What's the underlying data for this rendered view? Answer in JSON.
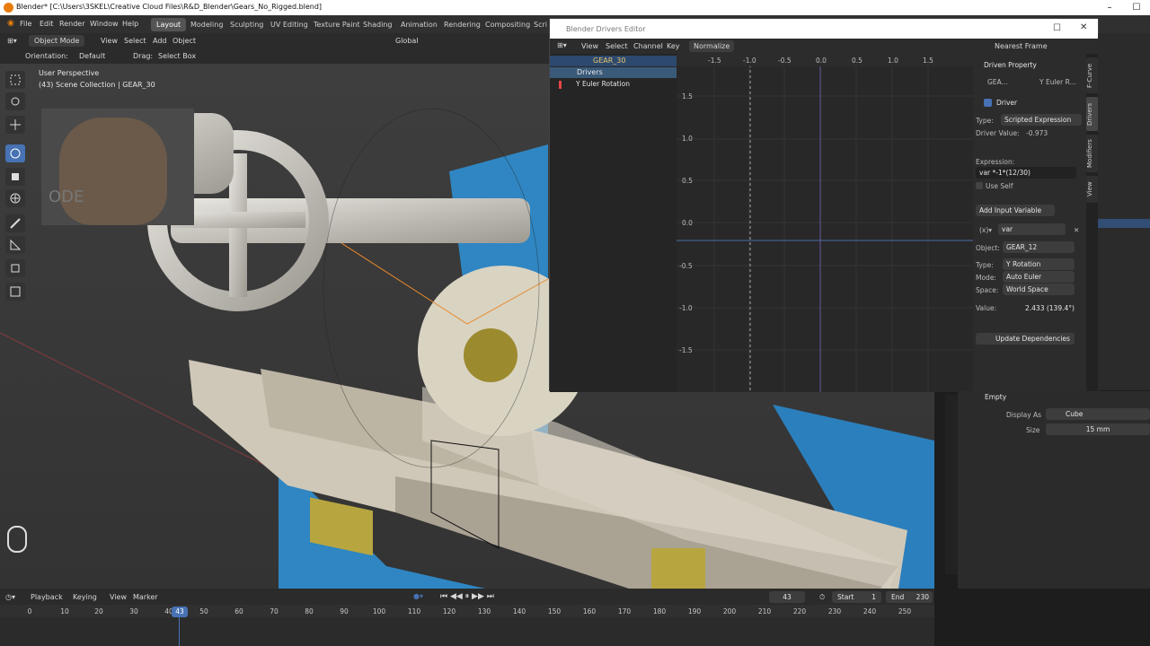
{
  "window": {
    "title": "Blender* [C:\\Users\\3SKEL\\Creative Cloud Files\\R&D_Blender\\Gears_No_Rigged.blend]"
  },
  "menu": [
    "File",
    "Edit",
    "Render",
    "Window",
    "Help"
  ],
  "workspace_tabs": [
    "Layout",
    "Modeling",
    "Sculpting",
    "UV Editing",
    "Texture Paint",
    "Shading",
    "Animation",
    "Rendering",
    "Compositing",
    "Scri"
  ],
  "toolbar": {
    "mode": "Object Mode",
    "view": "View",
    "select": "Select",
    "add": "Add",
    "object": "Object",
    "transform": "Global"
  },
  "header2": {
    "orientation_label": "Orientation:",
    "orientation_value": "Default",
    "drag_label": "Drag:",
    "drag_value": "Select Box"
  },
  "viewport": {
    "perspective": "User Perspective",
    "collection": "(43) Scene Collection | GEAR_30",
    "webcam_text": "ODE"
  },
  "drivers_editor": {
    "title": "Blender Drivers Editor",
    "menu": [
      "View",
      "Select",
      "Channel",
      "Key"
    ],
    "normalize": "Normalize",
    "snap": "Nearest Frame",
    "channels": {
      "object": "GEAR_30",
      "group": "Drivers",
      "channel": "Y Euler Rotation"
    },
    "graph": {
      "x_ticks": [
        "-1.5",
        "-1.0",
        "-0.5",
        "0.0",
        "0.5",
        "1.0",
        "1.5"
      ],
      "y_ticks": [
        "1.5",
        "1.0",
        "0.5",
        "0.0",
        "-0.5",
        "-1.0",
        "-1.5"
      ]
    },
    "props": {
      "driven_property": "Driven Property",
      "driven_object": "GEA...",
      "driven_path": "Y Euler R...",
      "driver_section": "Driver",
      "type_label": "Type:",
      "type_value": "Scripted Expression",
      "driver_value_label": "Driver Value:",
      "driver_value": "-0.973",
      "expression_label": "Expression:",
      "expression": "var *-1*(12/30)",
      "use_self": "Use Self",
      "add_variable": "Add Input Variable",
      "var_name": "var",
      "object_label": "Object:",
      "object_value": "GEAR_12",
      "var_type_label": "Type:",
      "var_type": "Y Rotation",
      "mode_label": "Mode:",
      "mode_value": "Auto Euler",
      "space_label": "Space:",
      "space_value": "World Space",
      "value_label": "Value:",
      "value": "2.433 (139.4°)",
      "update": "Update Dependencies"
    },
    "vtabs": [
      "F-Curve",
      "Drivers",
      "Modifiers",
      "View"
    ]
  },
  "lower_props": {
    "section": "Empty",
    "display_as_label": "Display As",
    "display_as": "Cube",
    "size_label": "Size",
    "size": "15 mm"
  },
  "timeline": {
    "menu": [
      "Playback",
      "Keying",
      "View",
      "Marker"
    ],
    "current_frame": "43",
    "start_label": "Start",
    "start": "1",
    "end_label": "End",
    "end": "230",
    "ticks": [
      "0",
      "10",
      "20",
      "30",
      "40",
      "50",
      "60",
      "70",
      "80",
      "90",
      "100",
      "110",
      "120",
      "130",
      "140",
      "150",
      "160",
      "170",
      "180",
      "190",
      "200",
      "210",
      "220",
      "230",
      "240",
      "250"
    ],
    "playhead": "43"
  },
  "colors": {
    "accent": "#4772b3",
    "orange": "#e87d0d",
    "gear_blue": "#2f86c2",
    "header": "#303030"
  }
}
